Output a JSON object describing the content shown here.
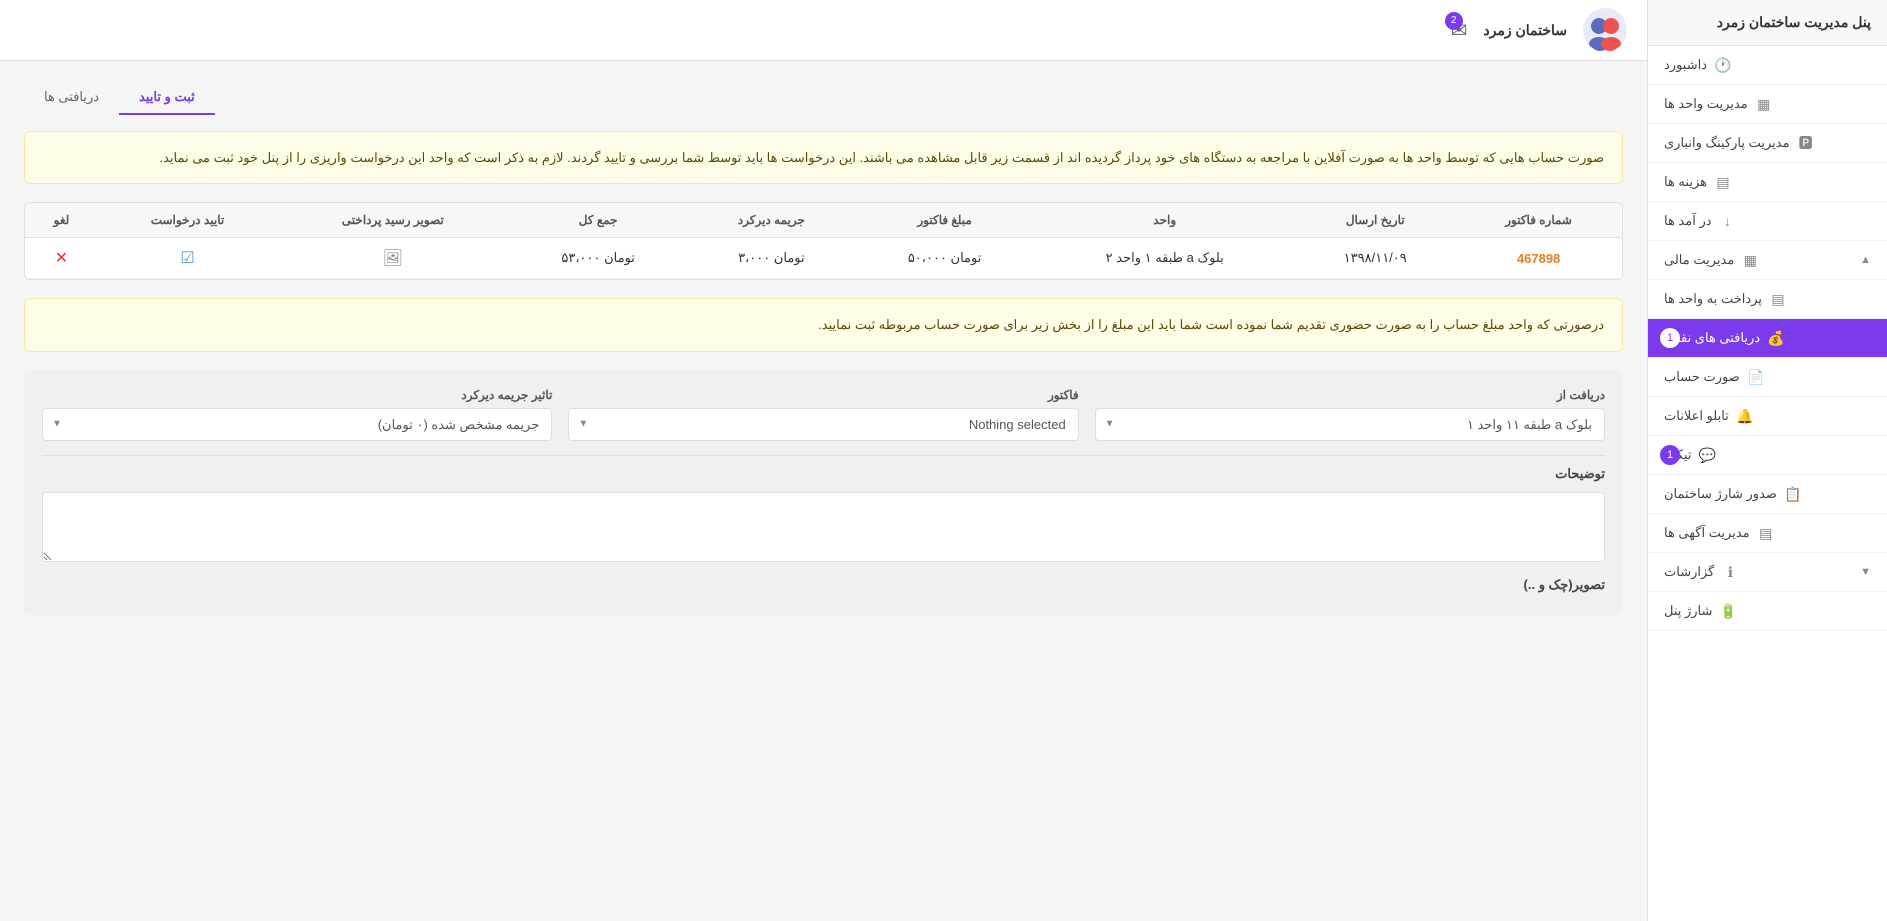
{
  "sidebar": {
    "title": "پنل مدیریت ساختمان زمرد",
    "items": [
      {
        "id": "dashboard",
        "label": "داشبورد",
        "icon": "🕐",
        "active": false,
        "badge": null
      },
      {
        "id": "units",
        "label": "مدیریت واحد ها",
        "icon": "▦",
        "active": false,
        "badge": null
      },
      {
        "id": "parking",
        "label": "مدیریت پارکینگ وانباری",
        "icon": "🅿",
        "active": false,
        "badge": null
      },
      {
        "id": "expenses",
        "label": "هزینه ها",
        "icon": "▤",
        "active": false,
        "badge": null
      },
      {
        "id": "income",
        "label": "در آمد ها",
        "icon": "↓",
        "active": false,
        "badge": null
      },
      {
        "id": "financial",
        "label": "مدیریت مالی",
        "icon": "▦",
        "active": false,
        "badge": null,
        "expandable": true,
        "expanded": true
      },
      {
        "id": "pay-units",
        "label": "پرداخت به واحد ها",
        "icon": "▤",
        "active": false,
        "badge": null
      },
      {
        "id": "cash-receive",
        "label": "دریافتی های نقدی",
        "icon": "💰",
        "active": true,
        "badge": "1"
      },
      {
        "id": "invoice",
        "label": "صورت حساب",
        "icon": "📄",
        "active": false,
        "badge": null
      },
      {
        "id": "bulletin",
        "label": "تابلو اعلانات",
        "icon": "🔔",
        "active": false,
        "badge": null
      },
      {
        "id": "ticket",
        "label": "تیکت",
        "icon": "💬",
        "active": false,
        "badge": "1"
      },
      {
        "id": "charge-issue",
        "label": "صدور شارژ ساختمان",
        "icon": "📋",
        "active": false,
        "badge": null
      },
      {
        "id": "ads",
        "label": "مدیریت آگهی ها",
        "icon": "▤",
        "active": false,
        "badge": null
      },
      {
        "id": "reports",
        "label": "گزارشات",
        "icon": "ℹ",
        "active": false,
        "badge": null,
        "expandable": true
      },
      {
        "id": "charge-panel",
        "label": "شارژ پنل",
        "icon": "🔋",
        "active": false,
        "badge": null
      }
    ]
  },
  "header": {
    "title": "ساختمان زمرد",
    "notification_badge": "2"
  },
  "tabs": [
    {
      "id": "register",
      "label": "ثبت و تایید",
      "active": true
    },
    {
      "id": "received",
      "label": "دریافتی ها",
      "active": false
    }
  ],
  "alert1": {
    "text": "صورت حساب هایی که توسط واحد ها به صورت آفلاین با مراجعه به دستگاه های خود پرداز گردیده اند از قسمت زیر قابل مشاهده می باشند. این درخواست ها باید توسط شما بررسی و تایید گردند. لازم به ذکر است که واحد این درخواست واریزی را از پنل خود ثبت می نماید."
  },
  "table": {
    "headers": [
      "شماره فاکتور",
      "تاریخ ارسال",
      "واحد",
      "مبلغ فاکتور",
      "جریمه دیرکرد",
      "جمع کل",
      "تصویر رسید پرداختی",
      "تایید درخواست",
      "لغو"
    ],
    "rows": [
      {
        "invoice_number": "467898",
        "send_date": "۱۳۹۸/۱۱/۰۹",
        "unit": "بلوک a طبقه ۱ واحد ۲",
        "invoice_amount": "تومان ۵۰،۰۰۰",
        "late_fee": "تومان ۳،۰۰۰",
        "total": "تومان ۵۳،۰۰۰",
        "receipt": "image",
        "confirm": "check",
        "cancel": "x"
      }
    ]
  },
  "alert2": {
    "text": "درصورتی که واحد مبلغ حساب را به صورت حضوری تقدیم شما نموده است شما باید این مبلغ را از بخش زیر برای صورت حساب مربوطه ثبت نمایید."
  },
  "form": {
    "receive_from_label": "دریافت از",
    "receive_from_value": "بلوک a طبقه ۱۱ واحد ۱",
    "invoice_label": "فاکتور",
    "invoice_placeholder": "Nothing selected",
    "late_fee_label": "تاثیر جریمه دیرکرد",
    "late_fee_value": "جریمه مشخص شده (۰ تومان)",
    "description_label": "توضیحات",
    "description_placeholder": "",
    "image_label": "تصویر(چک و ..)"
  }
}
